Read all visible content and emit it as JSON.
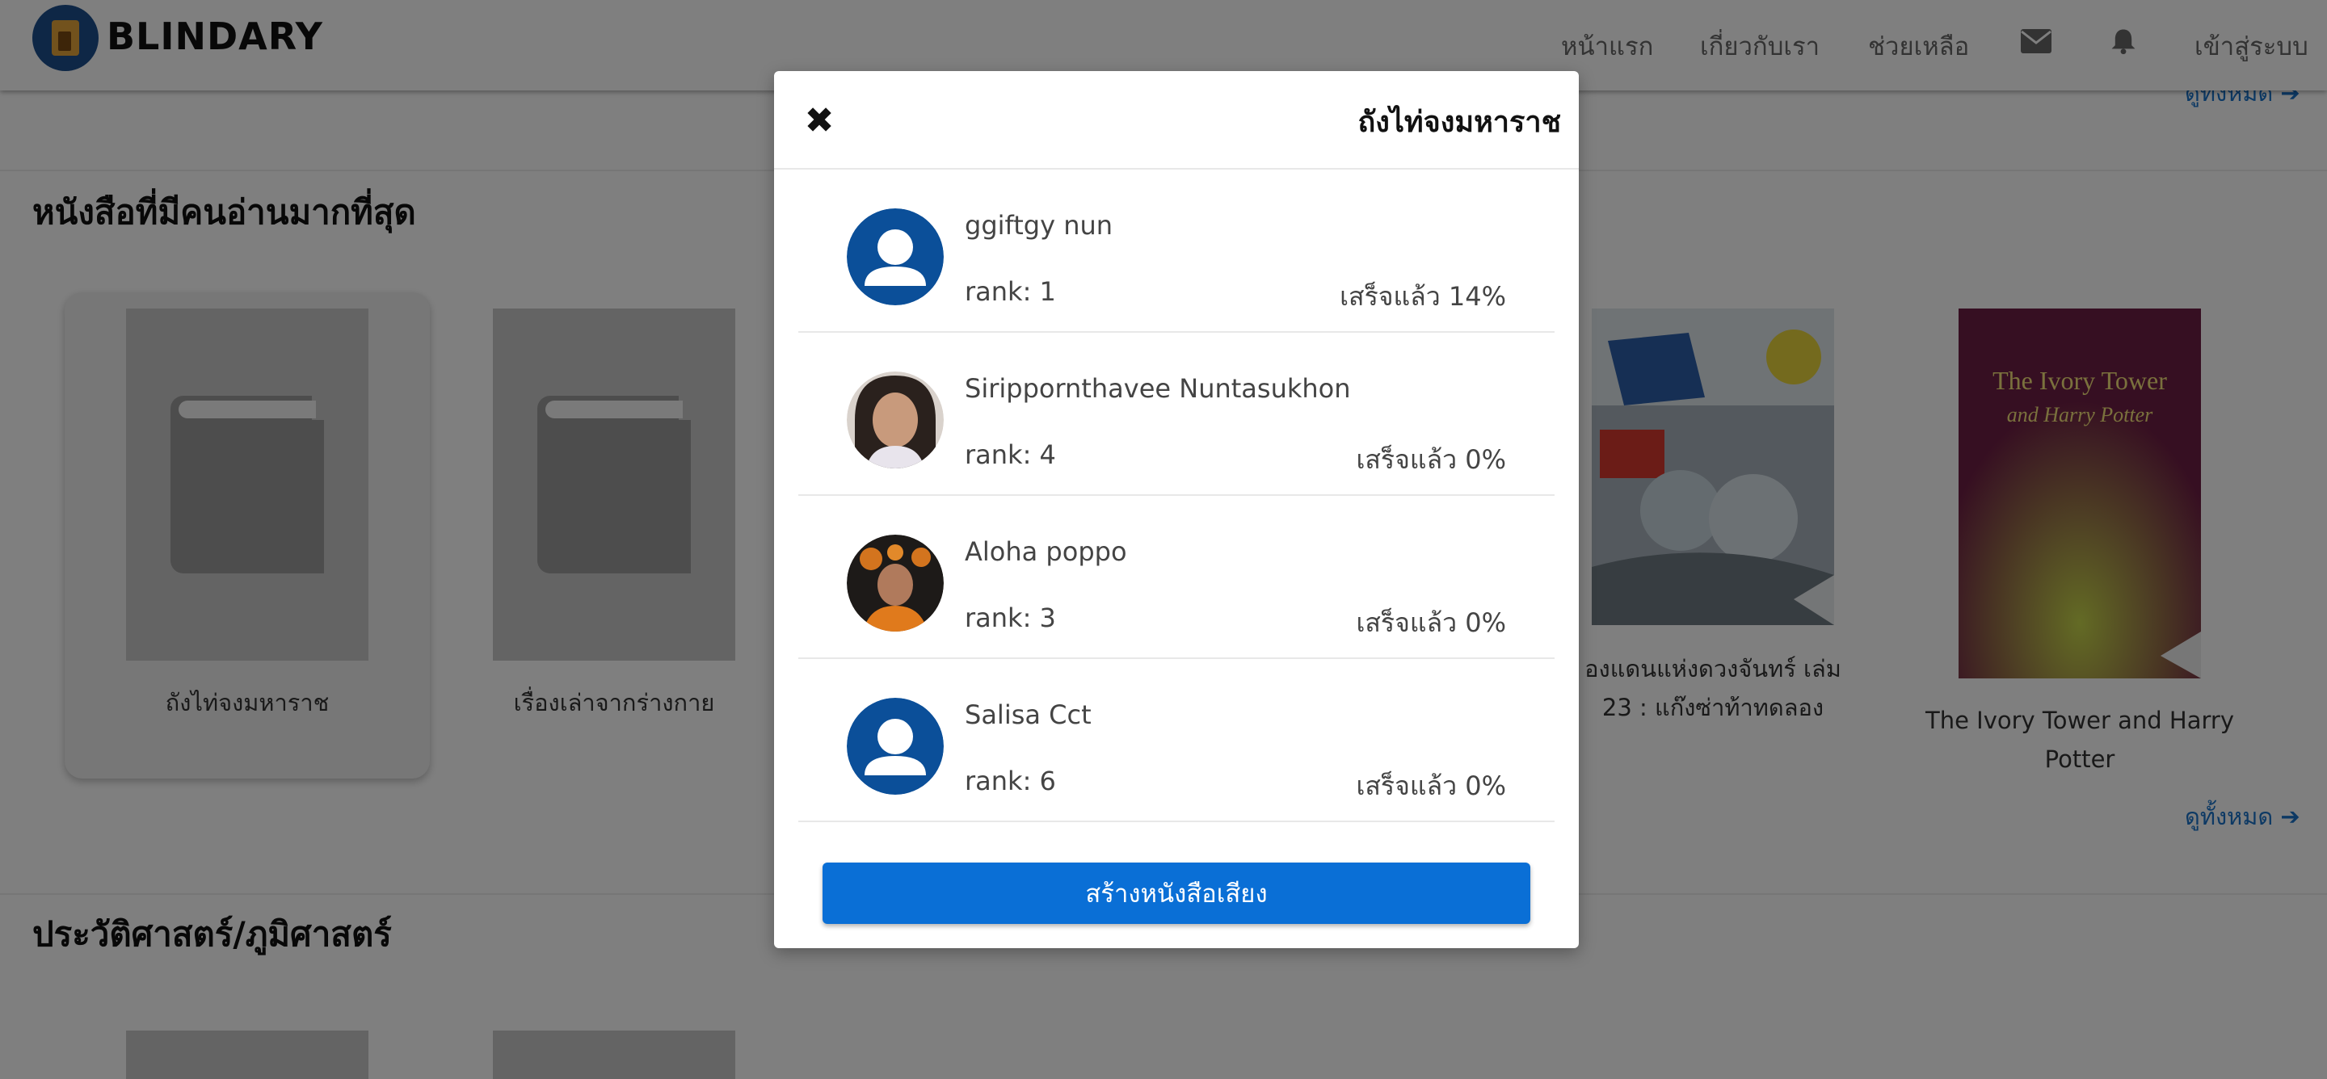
{
  "header": {
    "brand": "BLINDARY",
    "nav": {
      "home": "หน้าแรก",
      "about": "เกี่ยวกับเรา",
      "help": "ช่วยเหลือ",
      "login": "เข้าสู่ระบบ"
    },
    "icons": [
      "envelope-icon",
      "bell-icon"
    ]
  },
  "sections": [
    {
      "title": "หนังสือที่มีคนอ่านมากที่สุด",
      "see_all": "ดูทั้งหมด",
      "books": [
        {
          "title": "ถังไท่จงมหาราช"
        },
        {
          "title": "เรื่องเล่าจากร่างกาย"
        },
        {
          "title": "องแดนแห่งดวงจันทร์ เล่ม 23 : แก๊งซ่าท้าทดลอง"
        },
        {
          "title": "The Ivory Tower and Harry Potter"
        }
      ]
    },
    {
      "title": "ประวัติศาสตร์/ภูมิศาสตร์"
    }
  ],
  "top_see_all": "ดูทั้งหมด",
  "modal": {
    "title": "ถังไท่จงมหาราช",
    "close_icon": "close-icon",
    "readers": [
      {
        "name": "ggiftgy nun",
        "rank": "rank: 1",
        "progress": "เสร็จแล้ว 14%",
        "avatar": "default-user-avatar"
      },
      {
        "name": "Sirippornthavee Nuntasukhon",
        "rank": "rank: 4",
        "progress": "เสร็จแล้ว 0%",
        "avatar": "photo-avatar"
      },
      {
        "name": "Aloha poppo",
        "rank": "rank: 3",
        "progress": "เสร็จแล้ว 0%",
        "avatar": "photo-avatar"
      },
      {
        "name": "Salisa Cct",
        "rank": "rank: 6",
        "progress": "เสร็จแล้ว 0%",
        "avatar": "default-user-avatar"
      }
    ],
    "create_button": "สร้างหนังสือเสียง"
  },
  "colors": {
    "accent": "#0a6fd6",
    "link": "#1a73c9",
    "avatar_default": "#0b4f99"
  }
}
